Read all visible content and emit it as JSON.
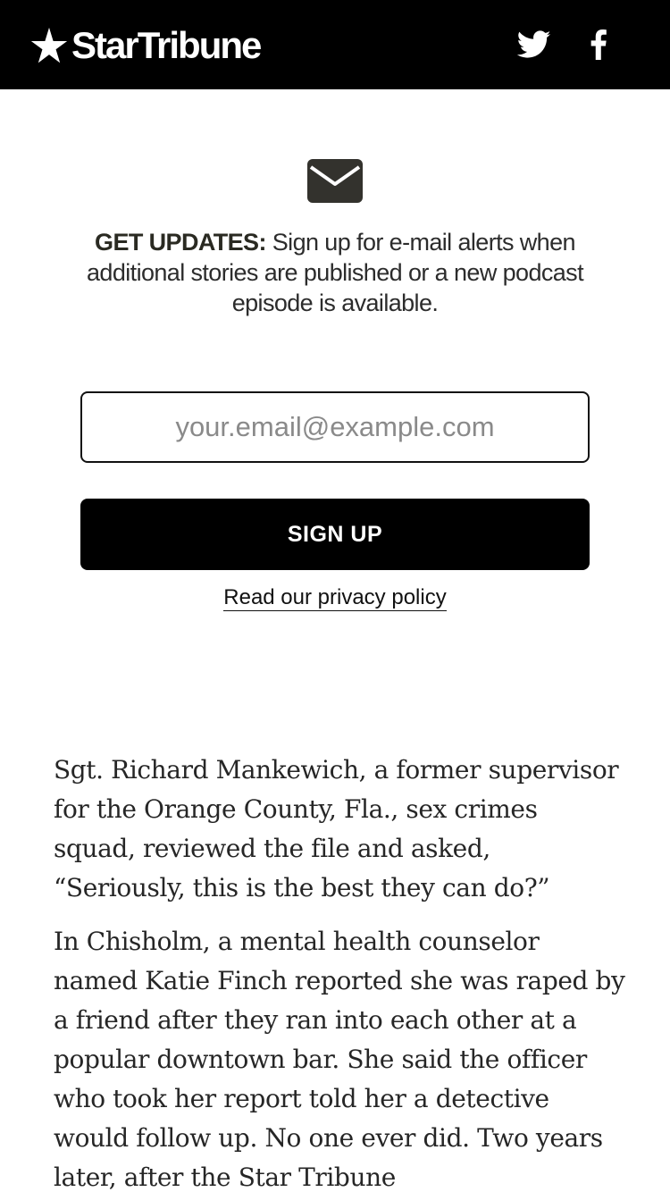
{
  "header": {
    "logo_text": "StarTribune",
    "logo_icon": "star-icon",
    "social": [
      {
        "name": "twitter-icon"
      },
      {
        "name": "facebook-icon"
      }
    ]
  },
  "signup": {
    "icon": "mail-icon",
    "lead": "GET UPDATES:",
    "description": "Sign up for e-mail alerts when additional stories are published or a new podcast episode is available.",
    "email_placeholder": "your.email@example.com",
    "email_value": "",
    "button_label": "SIGN UP",
    "privacy_label": "Read our privacy policy"
  },
  "article": {
    "paragraphs": [
      "Sgt. Richard Mankewich, a former supervisor for the Orange County, Fla., sex crimes squad, reviewed the file and asked, “Seriously, this is the best they can do?”",
      "In Chisholm, a mental health counselor named Katie Finch reported she was raped by a friend after they ran into each other at a popular downtown bar. She said the officer who took her report told her a detective would follow up. No one ever did. Two years later, after the Star Tribune"
    ]
  },
  "colors": {
    "header_bg": "#000000",
    "button_bg": "#000000",
    "icon_color": "#33322d"
  }
}
